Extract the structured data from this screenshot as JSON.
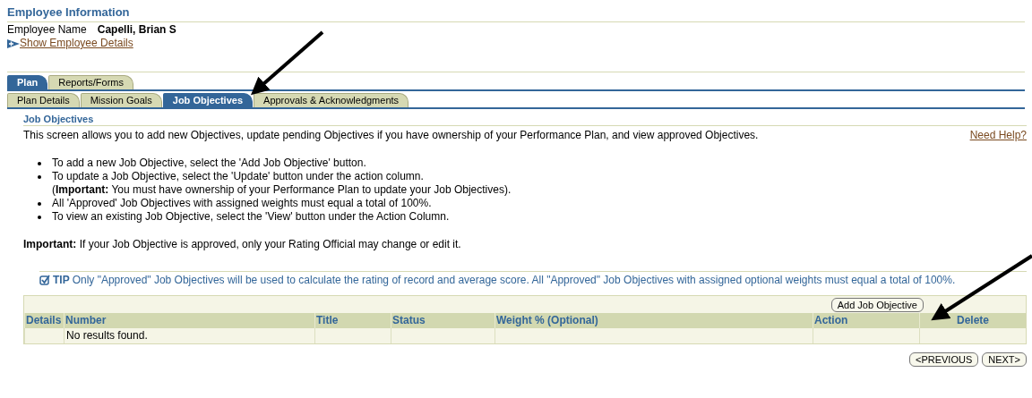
{
  "header": {
    "title": "Employee Information",
    "name_label": "Employee Name",
    "name_value": "Capelli, Brian S",
    "details_link": "Show Employee Details"
  },
  "tabs": [
    {
      "label": "Plan",
      "selected": true
    },
    {
      "label": "Reports/Forms",
      "selected": false
    }
  ],
  "subtabs": [
    {
      "label": "Plan Details",
      "selected": false
    },
    {
      "label": "Mission Goals",
      "selected": false
    },
    {
      "label": "Job Objectives",
      "selected": true
    },
    {
      "label": "Approvals & Acknowledgments",
      "selected": false
    }
  ],
  "section": {
    "title": "Job Objectives",
    "intro": "This screen allows you to add new Objectives, update pending Objectives if you have ownership of your Performance Plan, and view approved Objectives.",
    "help_link": "Need Help?"
  },
  "bullets": [
    {
      "text": "To add a new Job Objective, select the 'Add Job Objective' button."
    },
    {
      "text": "To update a Job Objective, select the 'Update' button under the action column.",
      "note": "(**Important:** You must have ownership of your Performance Plan to update your Job Objectives)."
    },
    {
      "text": "All 'Approved' Job Objectives with assigned weights must equal a total of 100%."
    },
    {
      "text": "To view an existing Job Objective, select the 'View' button under the Action Column."
    }
  ],
  "important": "**Important:** If your Job Objective is approved, only your Rating Official may change or edit it.",
  "tip": {
    "label": "TIP",
    "text": "Only \"Approved\" Job Objectives will be used to calculate the rating of record and average score. All \"Approved\" Job Objectives with assigned optional weights must equal a total of 100%."
  },
  "table": {
    "add_button": "Add Job Objective",
    "columns": [
      "Details",
      "Number",
      "Title",
      "Status",
      "Weight % (Optional)",
      "Action",
      "Delete"
    ],
    "empty_message": "No results found."
  },
  "nav": [
    "<PREVIOUS",
    "NEXT>"
  ]
}
